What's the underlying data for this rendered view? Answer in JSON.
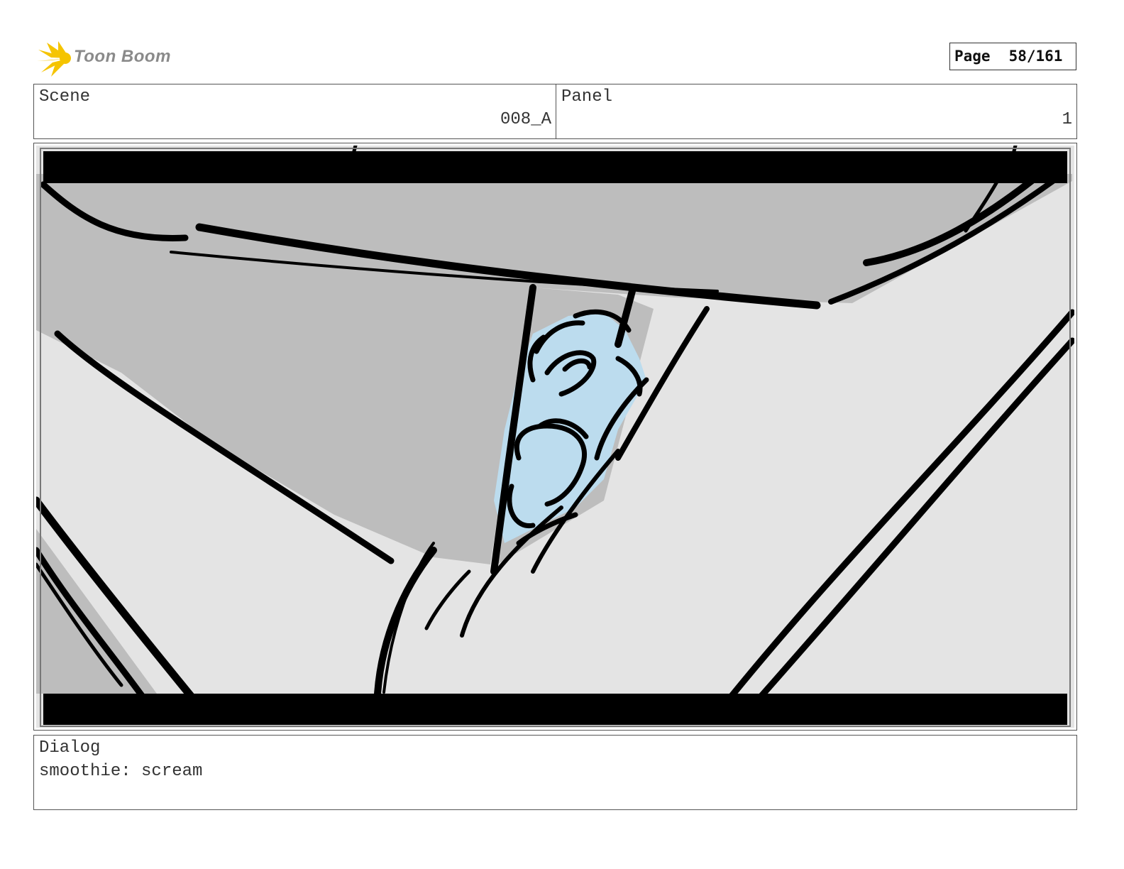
{
  "header": {
    "logo_text": "Toon Boom",
    "page_label": "Page",
    "page_number": "58/161"
  },
  "scene": {
    "label": "Scene",
    "value": "008_A"
  },
  "panel": {
    "label": "Panel",
    "value": "1"
  },
  "dialog": {
    "label": "Dialog",
    "text": "smoothie: scream"
  },
  "colors": {
    "letterbox": "#000000",
    "background_gray": "#bdbdbd",
    "light_gray": "#e4e4e4",
    "character_blue": "#bcdcee",
    "logo_yellow": "#f5c400"
  }
}
